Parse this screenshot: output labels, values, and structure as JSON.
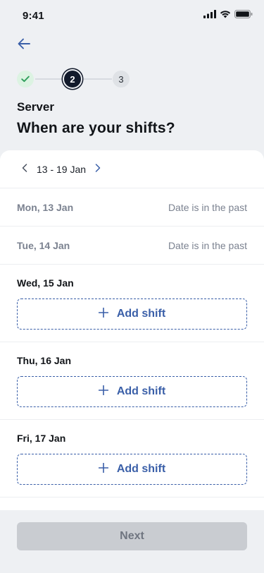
{
  "status_bar": {
    "time": "9:41",
    "icons": [
      "cellular-signal-icon",
      "wifi-icon",
      "battery-icon"
    ]
  },
  "header": {
    "back_icon": "arrow-left-icon",
    "stepper": {
      "steps": [
        {
          "state": "completed",
          "icon": "check-icon"
        },
        {
          "label": "2",
          "state": "current"
        },
        {
          "label": "3",
          "state": "upcoming"
        }
      ]
    },
    "role": "Server",
    "title": "When are your shifts?"
  },
  "week_nav": {
    "prev_icon": "chevron-left-icon",
    "range": "13 - 19 Jan",
    "next_icon": "chevron-right-icon"
  },
  "days": [
    {
      "label": "Mon, 13 Jan",
      "note": "Date is in the past",
      "state": "past"
    },
    {
      "label": "Tue, 14 Jan",
      "note": "Date is in the past",
      "state": "past"
    },
    {
      "label": "Wed, 15 Jan",
      "action": "Add shift",
      "state": "open"
    },
    {
      "label": "Thu, 16 Jan",
      "action": "Add shift",
      "state": "open"
    },
    {
      "label": "Fri, 17 Jan",
      "action": "Add shift",
      "state": "open"
    }
  ],
  "footer": {
    "next_label": "Next",
    "next_disabled": true
  },
  "colors": {
    "background": "#eef0f3",
    "accent": "#3a5fa8",
    "step_done_bg": "#dcf3e2",
    "step_done_check": "#2f9e5b",
    "step_current_bg": "#121a2b",
    "disabled_button": "#c9ccd1",
    "muted_text": "#7b8290"
  }
}
